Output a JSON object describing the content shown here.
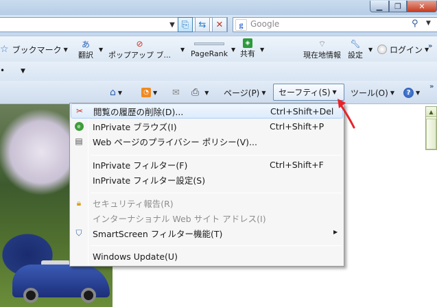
{
  "search": {
    "placeholder": "Google"
  },
  "google_toolbar": {
    "bookmarks": "ブックマーク",
    "translate": "翻訳",
    "popup": "ポップアップ ブ...",
    "pagerank": "PageRank",
    "share": "共有",
    "location": "現在地情報",
    "settings": "設定",
    "login": "ログイン"
  },
  "command_bar": {
    "page": "ページ(P)",
    "safety": "セーフティ(S)",
    "tools": "ツール(O)"
  },
  "menu": {
    "items": [
      {
        "label": "閲覧の履歴の削除(D)...",
        "shortcut": "Ctrl+Shift+Del"
      },
      {
        "label": "InPrivate ブラウズ(I)",
        "shortcut": "Ctrl+Shift+P"
      },
      {
        "label": "Web ページのプライバシー ポリシー(V)...",
        "shortcut": ""
      },
      {
        "label": "InPrivate フィルター(F)",
        "shortcut": "Ctrl+Shift+F"
      },
      {
        "label": "InPrivate フィルター設定(S)",
        "shortcut": ""
      },
      {
        "label": "セキュリティ報告(R)",
        "shortcut": ""
      },
      {
        "label": "インターナショナル Web サイト アドレス(I)",
        "shortcut": ""
      },
      {
        "label": "SmartScreen フィルター機能(T)",
        "shortcut": ""
      },
      {
        "label": "Windows Update(U)",
        "shortcut": ""
      }
    ]
  },
  "colors": {
    "accent_arrow": "#e8222a",
    "highlight": "#dcebfc"
  }
}
